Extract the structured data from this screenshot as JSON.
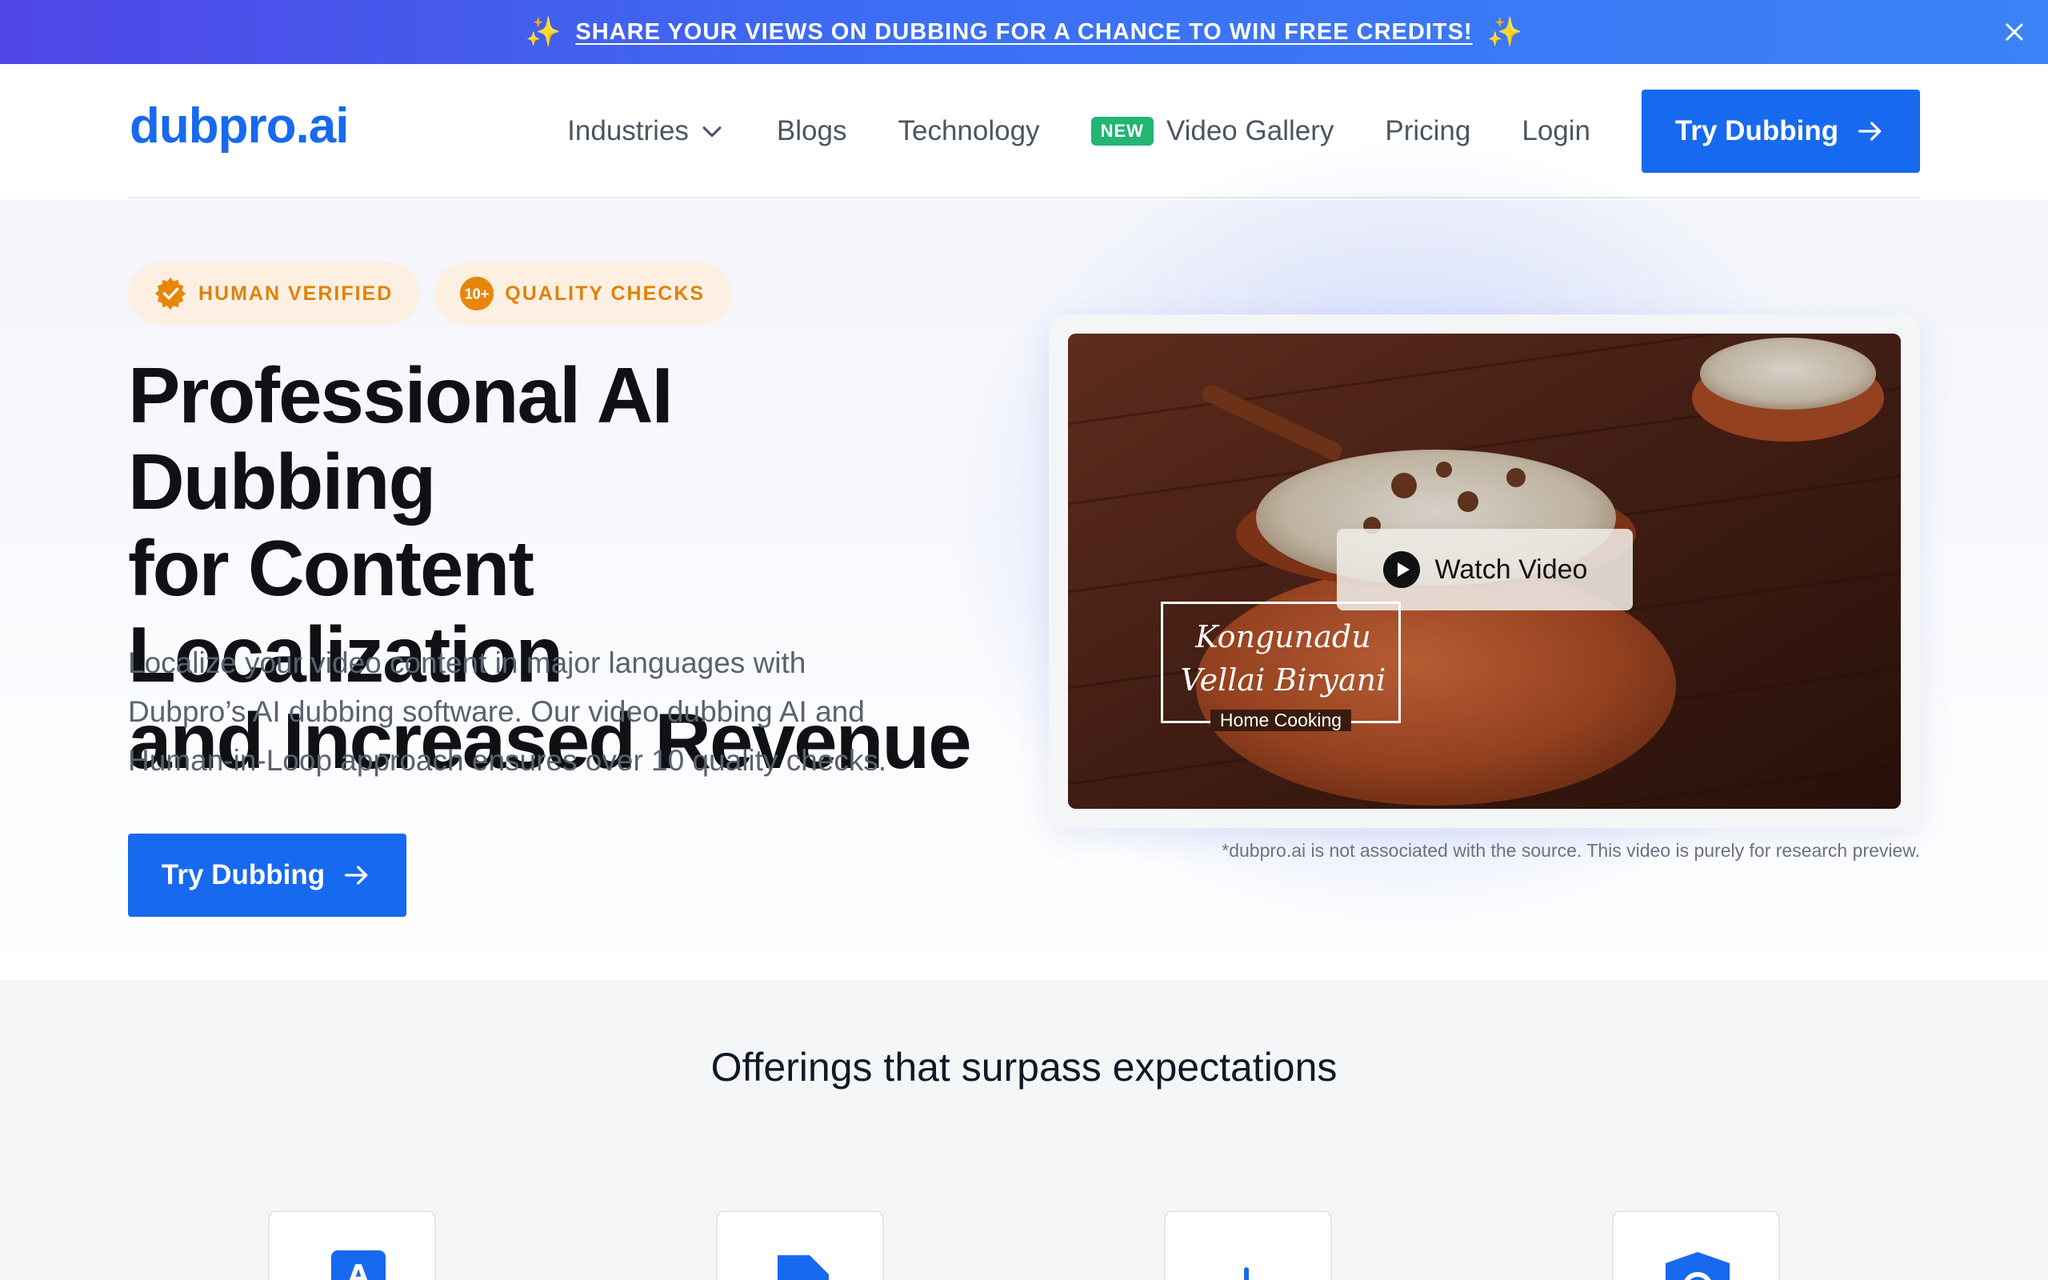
{
  "announcement": {
    "text": "SHARE YOUR VIEWS ON DUBBING FOR A CHANCE TO WIN FREE CREDITS!",
    "sparkle_left": "✨",
    "sparkle_right": "✨"
  },
  "header": {
    "logo": "dubpro.ai",
    "nav": {
      "industries": "Industries",
      "blogs": "Blogs",
      "technology": "Technology",
      "new_badge": "NEW",
      "video_gallery": "Video Gallery",
      "pricing": "Pricing",
      "login": "Login",
      "cta": "Try Dubbing"
    }
  },
  "hero": {
    "badges": [
      {
        "label": "HUMAN VERIFIED",
        "icon": "verified-seal-icon"
      },
      {
        "label": "QUALITY CHECKS",
        "icon": "10-plus-icon",
        "icon_text": "10+"
      }
    ],
    "headline_lines": [
      "Professional AI Dubbing",
      "for Content Localization",
      "and Increased Revenue"
    ],
    "subtext_lines": [
      "Localize your video content in major languages with",
      "Dubpro’s AI dubbing software. Our video dubbing AI and",
      "Human-in-Loop approach ensures over 10 quality checks."
    ],
    "cta": "Try Dubbing"
  },
  "video": {
    "watch_label": "Watch Video",
    "title_line1": "Kongunadu",
    "title_line2": "Vellai Biryani",
    "title_sub": "Home Cooking",
    "disclaimer": "*dubpro.ai is not associated with the source. This video is purely for research preview."
  },
  "offerings": {
    "title": "Offerings that surpass expectations",
    "cards": [
      {
        "icon": "translate-icon"
      },
      {
        "icon": "document-icon"
      },
      {
        "icon": "audio-wave-icon"
      },
      {
        "icon": "shield-icon"
      }
    ]
  },
  "colors": {
    "brand": "#1769f0",
    "badge_orange": "#e0820a",
    "new_badge_green": "#22b573"
  }
}
